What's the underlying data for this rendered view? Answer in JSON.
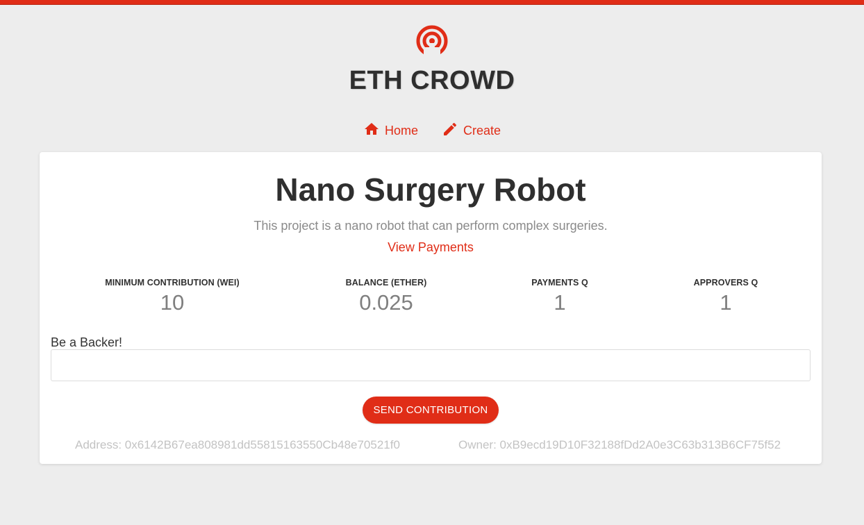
{
  "colors": {
    "accent": "#e02d17",
    "background": "#ededed",
    "card": "#ffffff"
  },
  "brand": {
    "title": "ETH CROWD",
    "icon": "broadcast-icon"
  },
  "nav": [
    {
      "label": "Home",
      "icon": "home-icon"
    },
    {
      "label": "Create",
      "icon": "pencil-icon"
    }
  ],
  "campaign": {
    "title": "Nano Surgery Robot",
    "description": "This project is a nano robot that can perform complex surgeries.",
    "view_payments_label": "View Payments"
  },
  "stats": [
    {
      "label": "MINIMUM CONTRIBUTION (WEI)",
      "value": "10"
    },
    {
      "label": "BALANCE (ETHER)",
      "value": "0.025"
    },
    {
      "label": "PAYMENTS Q",
      "value": "1"
    },
    {
      "label": "APPROVERS Q",
      "value": "1"
    }
  ],
  "contribute": {
    "label": "Be a Backer!",
    "value": "",
    "placeholder": "",
    "button_label": "SEND CONTRIBUTION"
  },
  "footer": {
    "address": "Address: 0x6142B67ea808981dd55815163550Cb48e70521f0",
    "owner": "Owner: 0xB9ecd19D10F32188fDd2A0e3C63b313B6CF75f52"
  }
}
